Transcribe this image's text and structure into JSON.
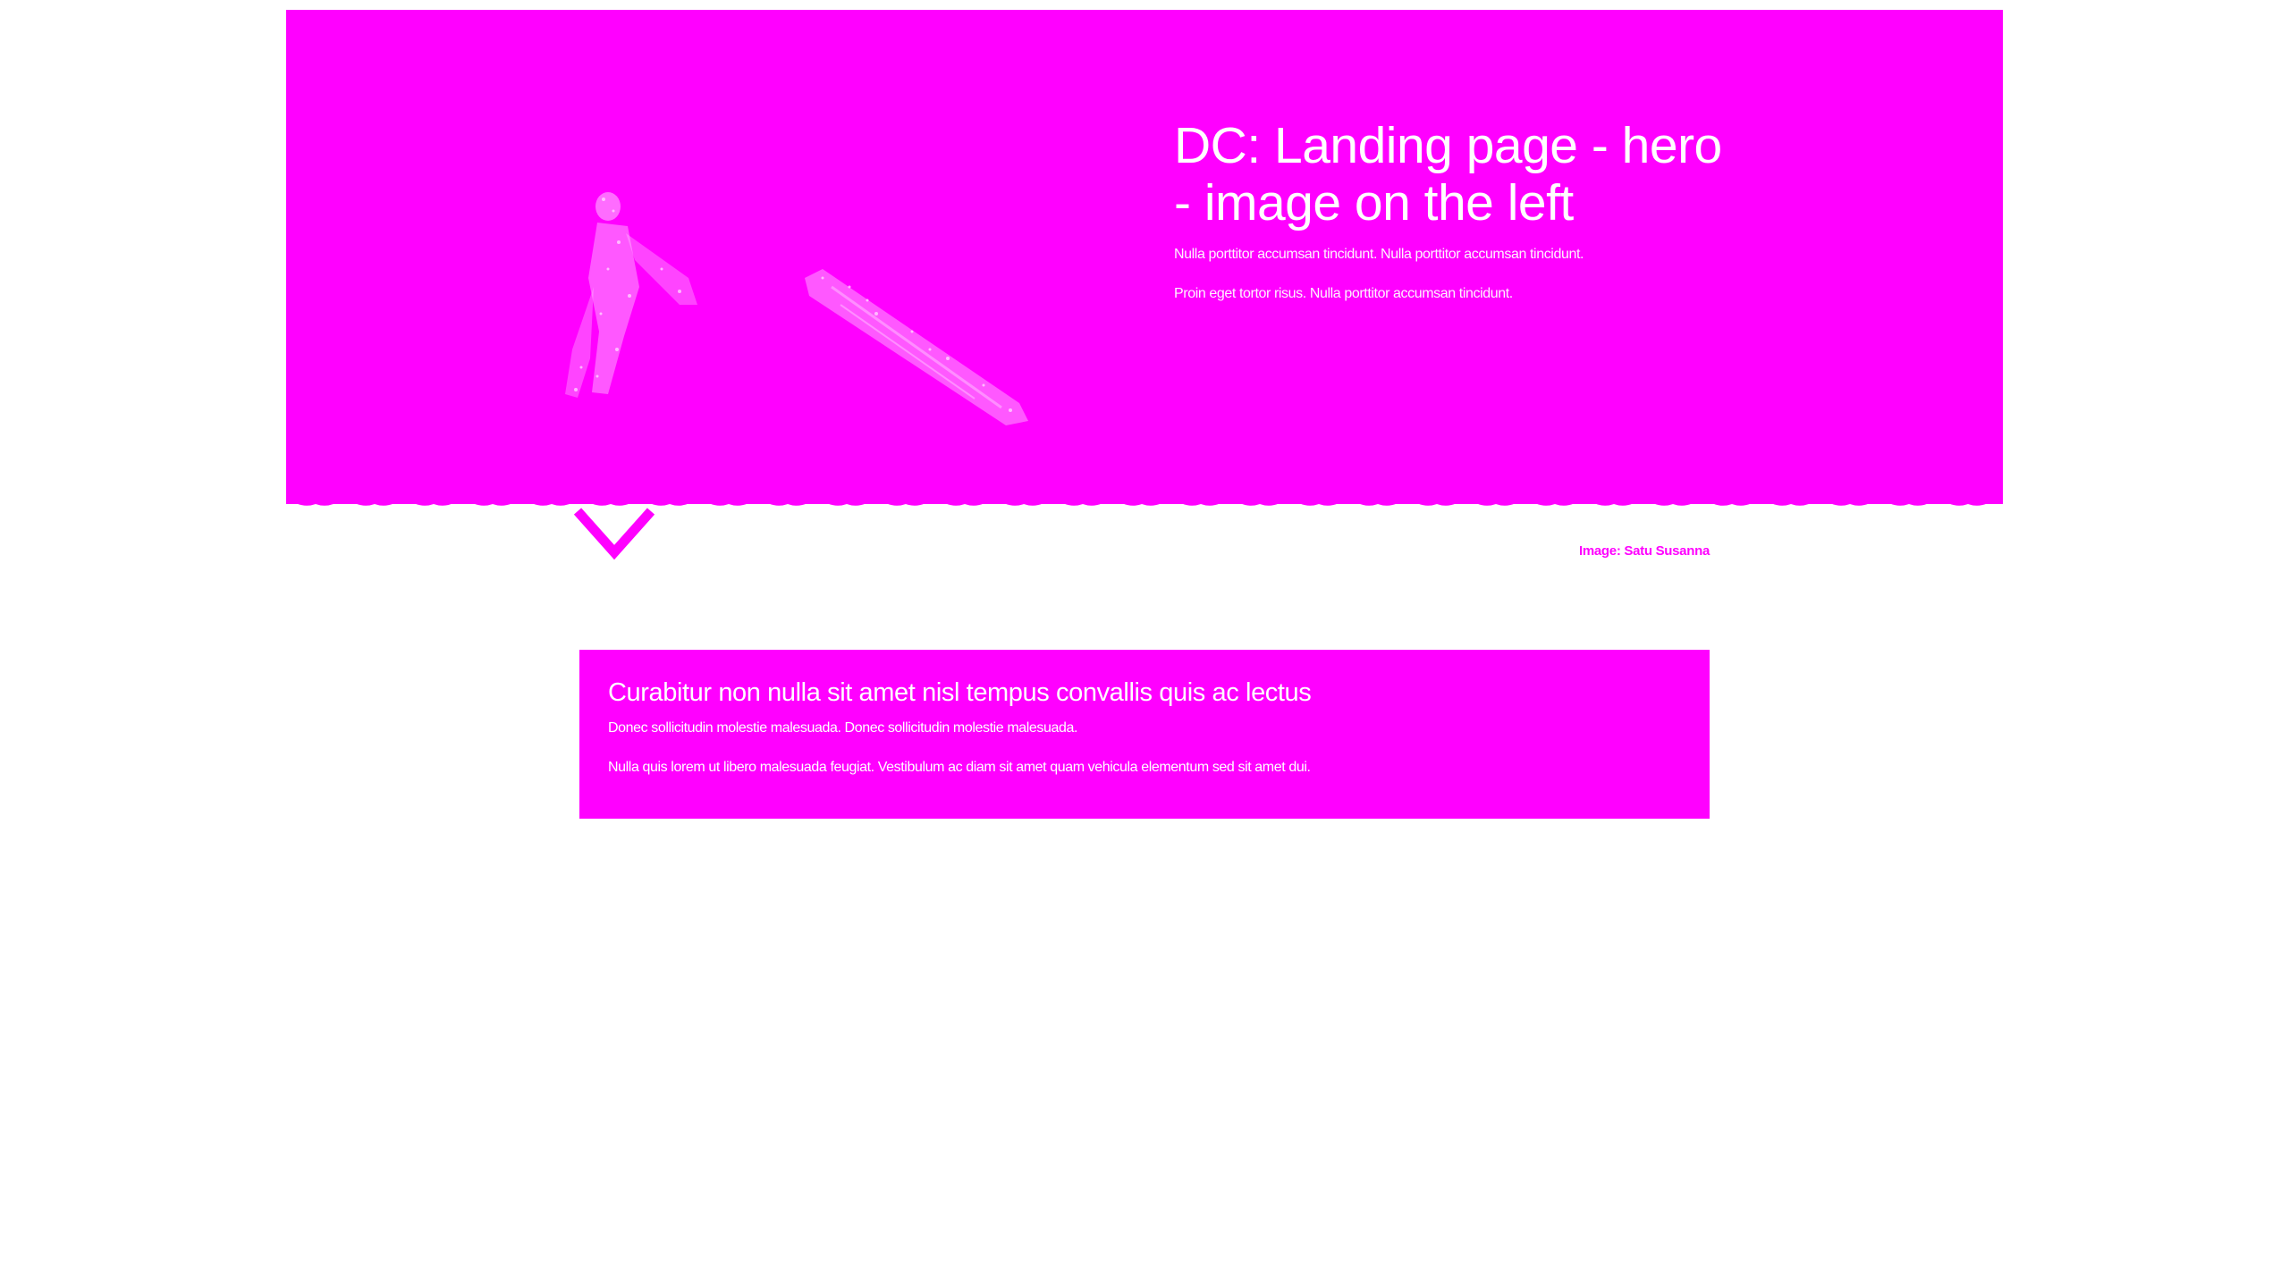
{
  "hero": {
    "title": "DC: Landing page - hero - image on the left",
    "paragraphs": [
      "Nulla porttitor accumsan tincidunt. Nulla porttitor accumsan tincidunt.",
      "Proin eget tortor risus. Nulla porttitor accumsan tincidunt."
    ],
    "image_alt": "kite-surfer-illustration",
    "background_color": "#ff00ff"
  },
  "scroll_arrow": {
    "icon": "chevron-down-icon",
    "color": "#ff00ff"
  },
  "image_credit": {
    "text": "Image: Satu Susanna"
  },
  "info_box": {
    "heading": "Curabitur non nulla sit amet nisl tempus convallis quis ac lectus",
    "paragraphs": [
      "Donec sollicitudin molestie malesuada. Donec sollicitudin molestie malesuada.",
      "Nulla quis lorem ut libero malesuada feugiat. Vestibulum ac diam sit amet quam vehicula elementum sed sit amet dui."
    ],
    "background_color": "#ff00ff"
  },
  "colors": {
    "accent": "#ff00ff",
    "text_on_accent": "#ffffff",
    "page_background": "#ffffff"
  }
}
